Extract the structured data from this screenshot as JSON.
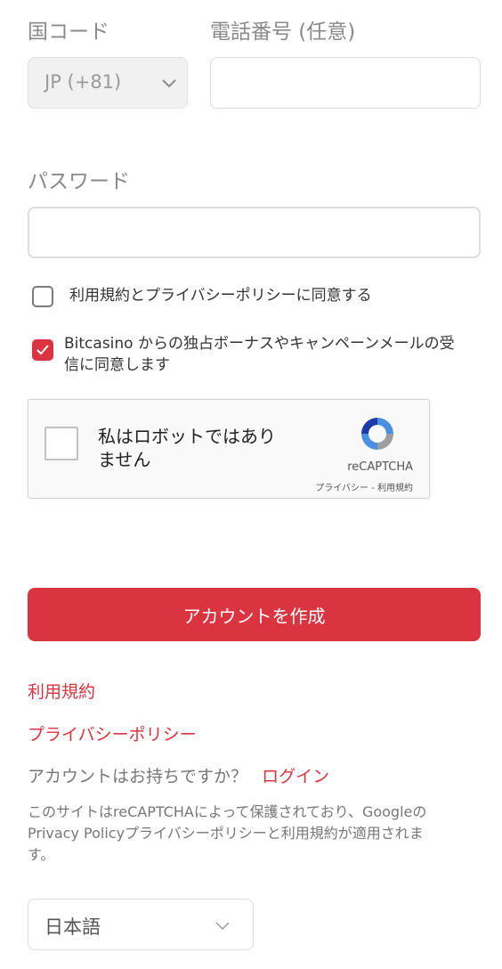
{
  "country": {
    "label": "国コード",
    "selected": "JP (+81)"
  },
  "phone": {
    "label": "電話番号 (任意)",
    "value": ""
  },
  "password": {
    "label": "パスワード",
    "value": ""
  },
  "terms_check": {
    "label": "利用規約とプライバシーポリシーに同意する",
    "checked": false
  },
  "promo_check": {
    "label_line1": "Bitcasino からの独占ボーナスやキャンペーンメールの受",
    "label_line2": "信に同意します",
    "checked": true
  },
  "recaptcha": {
    "label_line1": "私はロボットではあり",
    "label_line2": "ません",
    "brand": "reCAPTCHA",
    "privacy": "プライバシー",
    "separator": " - ",
    "terms": "利用規約"
  },
  "create_button": {
    "label": "アカウントを作成"
  },
  "links": {
    "terms": "利用規約",
    "privacy": "プライバシーポリシー"
  },
  "login_prompt": {
    "question": "アカウントはお持ちですか？",
    "link": "ログイン"
  },
  "footnote": {
    "line1": "このサイトはreCAPTCHAによって保護されており、Googleの",
    "line2": "Privacy Policyプライバシーポリシーと利用規約が適用されま",
    "line3": "す。"
  },
  "language": {
    "selected": "日本語"
  },
  "colors": {
    "accent": "#d9343f",
    "muted": "#8a8a8a"
  }
}
